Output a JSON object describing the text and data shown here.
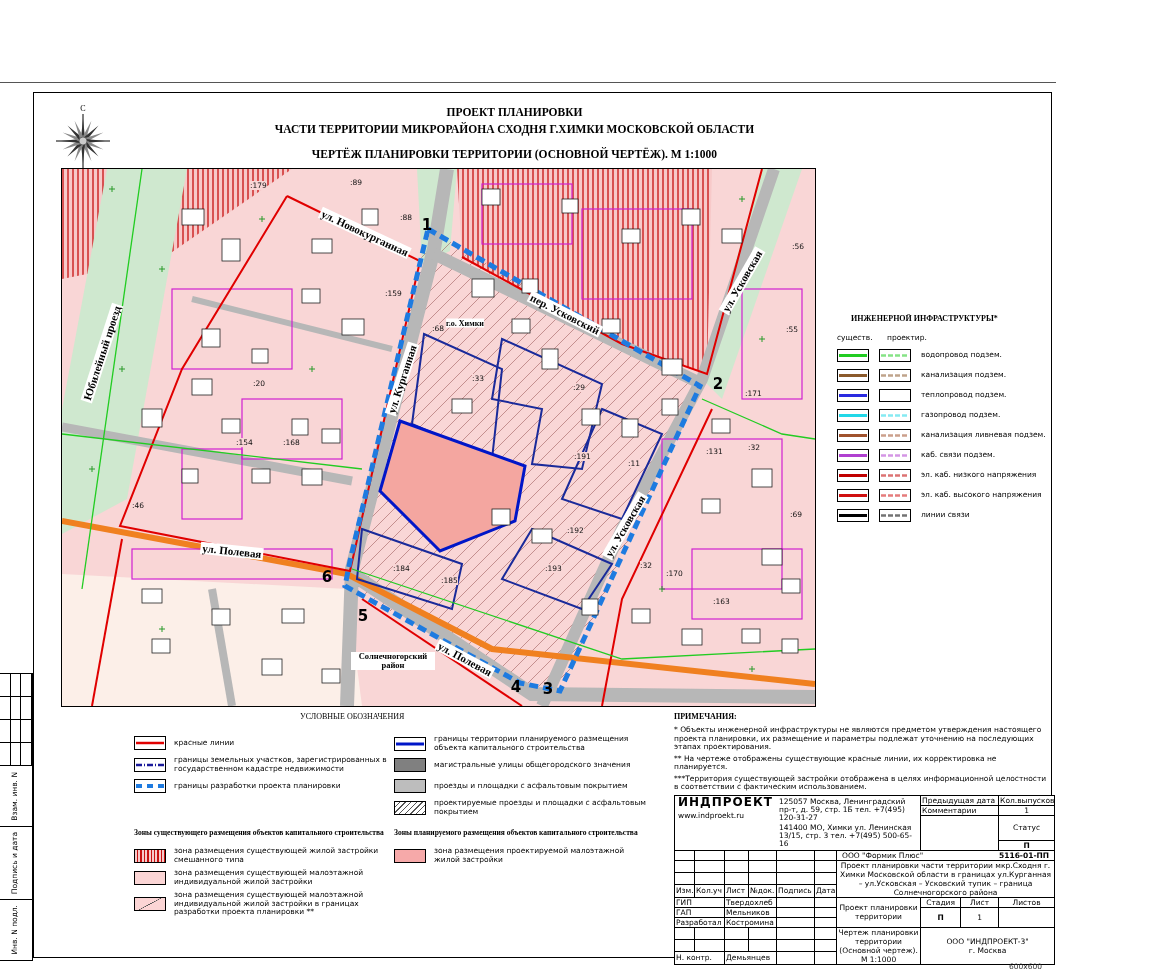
{
  "compass": {
    "label": "С"
  },
  "title": {
    "lines": [
      "ПРОЕКТ  ПЛАНИРОВКИ",
      "ЧАСТИ ТЕРРИТОРИИ МИКРОРАЙОНА СХОДНЯ Г.ХИМКИ  МОСКОВСКОЙ ОБЛАСТИ",
      "ЧЕРТЁЖ  ПЛАНИРОВКИ ТЕРРИТОРИИ (ОСНОВНОЙ ЧЕРТЁЖ). М 1:1000"
    ]
  },
  "map": {
    "streets": [
      "ул. Новокурганная",
      "пер. Усковский",
      "ул. Усковская",
      "ул. Курганная",
      "ул. Полевая",
      "ул. Полевая",
      "ул. Усковская",
      "Юбилейный проезд"
    ],
    "areas": [
      "г.о. Химки",
      "Солнечногорский район"
    ],
    "points": [
      "1",
      "2",
      "3",
      "4",
      "5",
      "6"
    ],
    "parcels": [
      ":179",
      ":89",
      ":88",
      ":159",
      ":68",
      ":33",
      ":29",
      ":191",
      ":11",
      ":192",
      ":193",
      ":185",
      ":184",
      ":46",
      ":154",
      ":168",
      ":20",
      ":171",
      ":131",
      ":32",
      ":32",
      ":170",
      ":163",
      ":69",
      ":55",
      ":56"
    ]
  },
  "infrastructure_legend": {
    "title": "ИНЖЕНЕРНОЙ  ИНФРАСТРУКТУРЫ*",
    "column_headers": [
      "существ.",
      "проектир."
    ],
    "rows": [
      {
        "label": "водопровод подзем.",
        "color": "#22cc22",
        "planned": true
      },
      {
        "label": "канализация подзем.",
        "color": "#8b5a2b",
        "planned": true
      },
      {
        "label": "теплопровод подзем.",
        "color": "#2a2ae0",
        "planned": false
      },
      {
        "label": "газопровод подзем.",
        "color": "#22d8e8",
        "planned": true
      },
      {
        "label": "канализация  ливневая подзем.",
        "color": "#a0522d",
        "planned": true
      },
      {
        "label": "каб. связи подзем.",
        "color": "#b040d0",
        "planned": true
      },
      {
        "label": "эл. каб. низкого напряжения",
        "color": "#c00000",
        "planned": true
      },
      {
        "label": "эл. каб. высокого напряжения",
        "color": "#d01010",
        "planned": true
      },
      {
        "label": "линии связи",
        "color": "#000000",
        "planned": true
      }
    ]
  },
  "legend": {
    "title": "УСЛОВНЫЕ  ОБОЗНАЧЕНИЯ",
    "columns": [
      [
        {
          "kind": "red-line",
          "label": "красные линии"
        },
        {
          "kind": "dashdot-line",
          "label": "границы земельных участков, зарегистрированных в государственном кадастре недвижимости"
        },
        {
          "kind": "dashed-line",
          "label": "границы разработки проекта планировки"
        }
      ],
      [
        {
          "kind": "blue-line",
          "label": "границы территории планируемого размещения объекта капитального строительства"
        },
        {
          "kind": "dark-fill",
          "label": "магистральные улицы общегородского значения"
        },
        {
          "kind": "gray-fill",
          "label": "проезды и площадки с асфальтовым покрытием"
        },
        {
          "kind": "hatch",
          "label": "проектируемые проезды и площадки с асфальтовым покрытием"
        }
      ]
    ],
    "zone_groups": [
      {
        "title": "Зоны существующего размещения объектов капитального строительства",
        "items": [
          {
            "kind": "vertical-hatch",
            "label": "зона размещения существующей жилой застройки смешанного типа"
          },
          {
            "kind": "pink-fill",
            "label": "зона размещения существующей малоэтажной индивидуальной жилой застройки"
          },
          {
            "kind": "pink-diagonal",
            "label": "зона размещения существующей малоэтажной индивидуальной жилой застройки в границах разработки проекта планировки **"
          }
        ]
      },
      {
        "title": "Зоны планируемого размещения объектов капитального строительства",
        "items": [
          {
            "kind": "salmon-fill",
            "label": "зона размещения проектируемой малоэтажной жилой застройки"
          }
        ]
      }
    ]
  },
  "notes": {
    "title": "ПРИМЕЧАНИЯ:",
    "items": [
      "*  Объекты инженерной инфраструктуры не являются предметом утверждения настоящего проекта планировки, их размещение и параметры подлежат уточнению на последующих этапах проектирования.",
      "** На чертеже отображены существующие красные линии, их корректировка не планируется.",
      "***Территория существующей застройки отображена в целях информационной целостности в соответствии с фактическим использованием."
    ]
  },
  "title_block": {
    "logo": "ИНДПРОЕКТ",
    "website": "www.indproekt.ru",
    "addresses": [
      "125057 Москва, Ленинградский пр-т, д. 59, стр. 1Б тел. +7(495) 120-31-27",
      "141400 МО, Химки ул. Ленинская 13/15, стр. 3 тел. +7(495) 500-65-16"
    ],
    "previous_date_label": "Предыдущая дата",
    "comments_label": "Комментарии",
    "issues_label": "Кол.выпусков",
    "issues": "1",
    "status_label": "Статус",
    "status": "П",
    "customer": "ООО \"Формик Плюс\"",
    "code": "5116-01-ПП",
    "project_title": "Проект  планировки части территории мкр.Сходня г. Химки Московской области в границах ул.Курганная – ул.Усковская – Усковский тупик – граница Солнечногорского района",
    "revision_headers": [
      "Изм.",
      "Кол.уч",
      "Лист",
      "№док.",
      "Подпись",
      "Дата"
    ],
    "staff": [
      {
        "role": "ГИП",
        "name": "Твердохлеб"
      },
      {
        "role": "ГАП",
        "name": "Мельников"
      },
      {
        "role": "Разработал",
        "name": "Костромина"
      },
      {
        "role": "Н. контр.",
        "name": "Демьянцев"
      }
    ],
    "document": "Проект планировки территории",
    "stage_label": "Стадия",
    "sheet_label": "Лист",
    "sheets_label": "Листов",
    "stage": "П",
    "sheet": "1",
    "drawing": "Чертеж планировки территории (Основной чертеж). М 1:1000",
    "company": "ООО \"ИНДПРОЕКТ-3\"",
    "city": "г. Москва"
  },
  "margin_stamp": {
    "labels": [
      "Взам. инв. N",
      "Подпись и дата",
      "Инв. N подл."
    ]
  },
  "sheet_size": "600х600"
}
